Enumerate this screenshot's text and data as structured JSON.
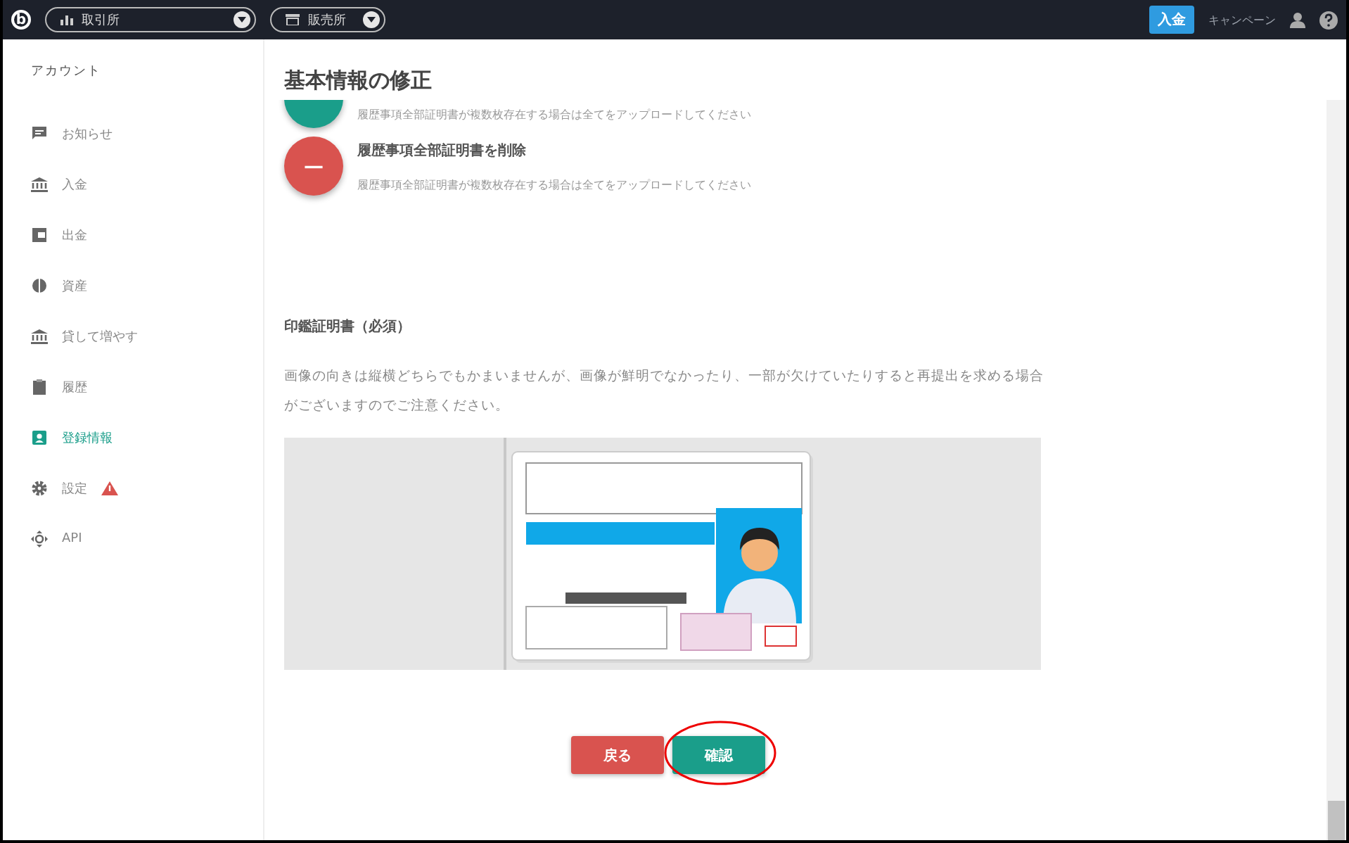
{
  "topbar": {
    "logo": "b",
    "selectors": [
      {
        "label": "取引所"
      },
      {
        "label": "販売所"
      }
    ],
    "deposit_button": "入金",
    "campaign_link": "キャンペーン"
  },
  "sidebar": {
    "heading": "アカウント",
    "items": [
      {
        "label": "お知らせ",
        "selected": false,
        "warning": false
      },
      {
        "label": "入金",
        "selected": false,
        "warning": false
      },
      {
        "label": "出金",
        "selected": false,
        "warning": false
      },
      {
        "label": "資産",
        "selected": false,
        "warning": false
      },
      {
        "label": "貸して増やす",
        "selected": false,
        "warning": false
      },
      {
        "label": "履歴",
        "selected": false,
        "warning": false
      },
      {
        "label": "登録情報",
        "selected": true,
        "warning": false
      },
      {
        "label": "設定",
        "selected": false,
        "warning": true
      },
      {
        "label": "API",
        "selected": false,
        "warning": false
      }
    ]
  },
  "main": {
    "title": "基本情報の修正",
    "uploads": [
      {
        "kind": "add",
        "note": "履歴事項全部証明書が複数枚存在する場合は全てをアップロードしてください"
      },
      {
        "kind": "remove",
        "symbol": "−",
        "title": "履歴事項全部証明書を削除",
        "note": "履歴事項全部証明書が複数枚存在する場合は全てをアップロードしてください"
      }
    ],
    "section_title": "印鑑証明書（必須）",
    "section_note": "画像の向きは縦横どちらでもかまいませんが、画像が鮮明でなかったり、一部が欠けていたりすると再提出を求める場合がございますのでご注意ください。",
    "buttons": [
      {
        "kind": "back",
        "label": "戻る",
        "highlighted": false
      },
      {
        "kind": "confirm",
        "label": "確認",
        "highlighted": true
      }
    ]
  }
}
